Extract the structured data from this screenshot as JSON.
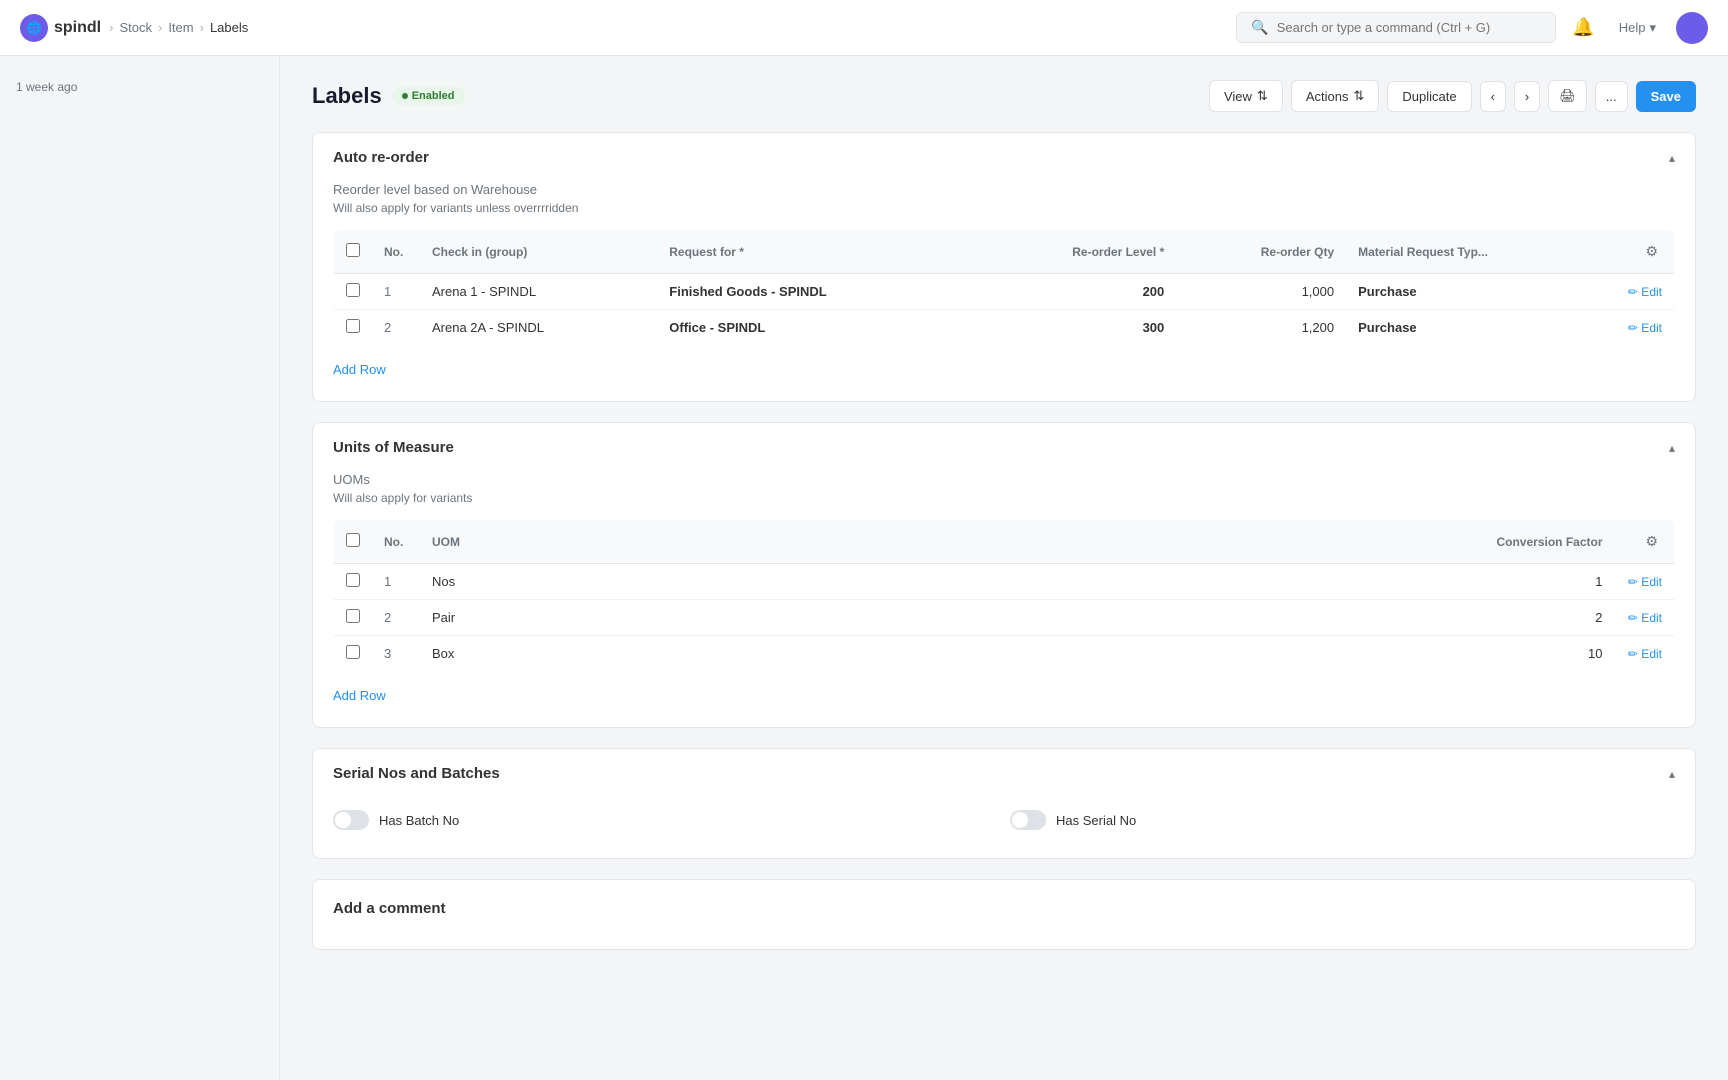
{
  "app": {
    "logo_text": "spindl",
    "logo_icon": "🌐"
  },
  "breadcrumb": {
    "items": [
      "Stock",
      "Item",
      "Labels"
    ]
  },
  "search": {
    "placeholder": "Search or type a command (Ctrl + G)"
  },
  "header": {
    "title": "Labels",
    "status": "Enabled",
    "buttons": {
      "view": "View",
      "actions": "Actions",
      "duplicate": "Duplicate",
      "save": "Save",
      "more": "..."
    }
  },
  "sidebar": {
    "timestamp": "1 week ago"
  },
  "sections": {
    "auto_reorder": {
      "title": "Auto re-order",
      "desc": "Reorder level based on Warehouse",
      "subdesc": "Will also apply for variants unless overrrridden",
      "columns": [
        "No.",
        "Check in (group)",
        "Request for *",
        "Re-order Level *",
        "Re-order Qty",
        "Material Request Typ..."
      ],
      "rows": [
        {
          "no": 1,
          "check_in_group": "Arena 1 - SPINDL",
          "request_for": "Finished Goods - SPINDL",
          "reorder_level": "200",
          "reorder_qty": "1,000",
          "material_request_type": "Purchase"
        },
        {
          "no": 2,
          "check_in_group": "Arena 2A - SPINDL",
          "request_for": "Office - SPINDL",
          "reorder_level": "300",
          "reorder_qty": "1,200",
          "material_request_type": "Purchase"
        }
      ],
      "add_row_label": "Add Row",
      "edit_label": "Edit"
    },
    "units_of_measure": {
      "title": "Units of Measure",
      "desc": "UOMs",
      "subdesc": "Will also apply for variants",
      "columns": [
        "No.",
        "UOM",
        "Conversion Factor"
      ],
      "rows": [
        {
          "no": 1,
          "uom": "Nos",
          "conversion_factor": "1"
        },
        {
          "no": 2,
          "uom": "Pair",
          "conversion_factor": "2"
        },
        {
          "no": 3,
          "uom": "Box",
          "conversion_factor": "10"
        }
      ],
      "add_row_label": "Add Row",
      "edit_label": "Edit"
    },
    "serial_nos_batches": {
      "title": "Serial Nos and Batches",
      "has_batch_no_label": "Has Batch No",
      "has_serial_no_label": "Has Serial No"
    },
    "add_comment": {
      "title": "Add a comment"
    }
  },
  "icons": {
    "search": "🔍",
    "bell": "🔔",
    "chevron_down": "▾",
    "chevron_left": "‹",
    "chevron_right": "›",
    "print": "🖨",
    "edit_pencil": "✏",
    "gear": "⚙",
    "chevron_up": "▴",
    "breadcrumb_sep": "›"
  }
}
